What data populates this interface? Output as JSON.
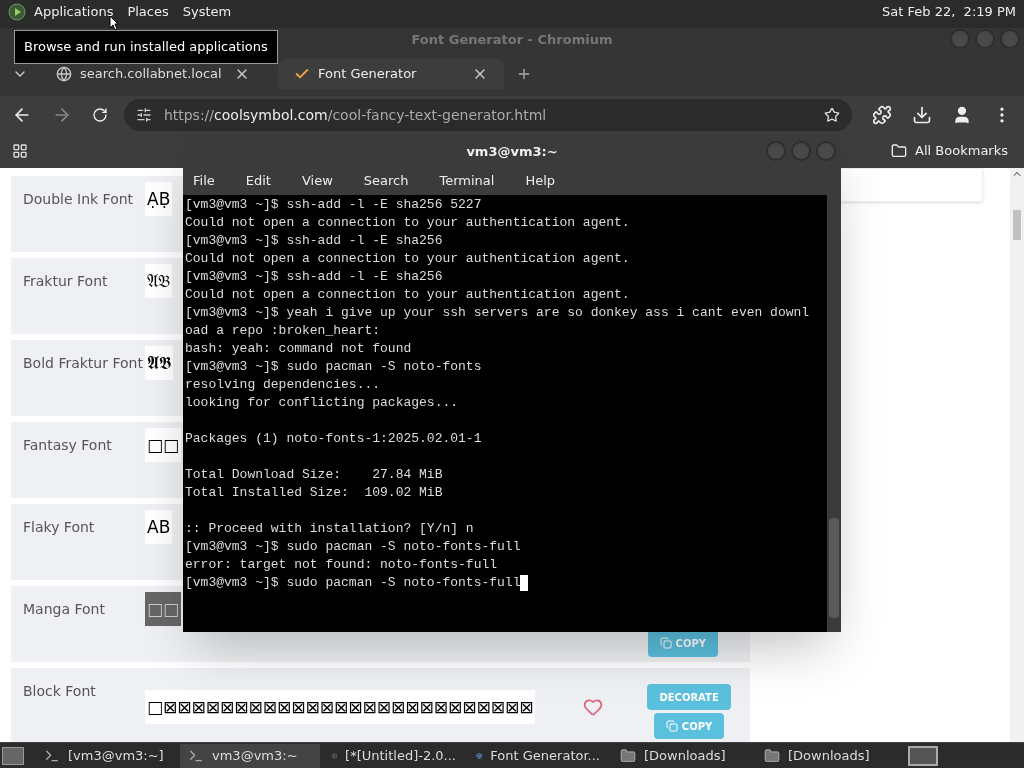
{
  "top_panel": {
    "menus": [
      "Applications",
      "Places",
      "System"
    ],
    "clock": "Sat Feb 22,  2:19 PM"
  },
  "tooltip": "Browse and run installed applications",
  "browser": {
    "title": "Font Generator - Chromium",
    "tabs": [
      {
        "label": "search.collabnet.local",
        "kind": "globe",
        "selected": false
      },
      {
        "label": "Font Generator",
        "kind": "check",
        "selected": true
      }
    ],
    "url": {
      "scheme": "https://",
      "domain": "coolsymbol.com",
      "path": "/cool-fancy-text-generator.html"
    },
    "bookmarks": "All Bookmarks",
    "fonts": [
      {
        "name": "Double Ink Font",
        "sample": "ẠḄ",
        "kind": "plain"
      },
      {
        "name": "Fraktur Font",
        "sample": "𝔄𝔅",
        "kind": "plain"
      },
      {
        "name": "Bold Fraktur Font",
        "sample": "𝕬𝕭",
        "kind": "plain"
      },
      {
        "name": "Fantasy Font",
        "sample": "□□",
        "kind": "plain"
      },
      {
        "name": "Flaky Font",
        "sample": "AB",
        "kind": "plain"
      },
      {
        "name": "Manga Font",
        "sample": "□□",
        "kind": "dark",
        "buttons": [
          "COPY"
        ]
      },
      {
        "name": "Block Font",
        "sample": "□⊠⊠⊠⊠⊠⊠⊠⊠⊠⊠⊠⊠⊠⊠⊠⊠⊠⊠⊠⊠⊠⊠⊠⊠⊠⊠",
        "kind": "plain",
        "favorite": false,
        "buttons": [
          "DECORATE",
          "COPY"
        ]
      }
    ]
  },
  "terminal": {
    "title": "vm3@vm3:~",
    "menus": [
      "File",
      "Edit",
      "View",
      "Search",
      "Terminal",
      "Help"
    ],
    "blocks": [
      [
        "[vm3@vm3 ~]$ ssh-add -l -E sha256 5227",
        "Could not open a connection to your authentication agent.",
        "[vm3@vm3 ~]$ ssh-add -l -E sha256",
        "Could not open a connection to your authentication agent.",
        "[vm3@vm3 ~]$ ssh-add -l -E sha256",
        "Could not open a connection to your authentication agent.",
        "[vm3@vm3 ~]$ yeah i give up your ssh servers are so donkey ass i cant even downl",
        "oad a repo :broken_heart:",
        "bash: yeah: command not found",
        "[vm3@vm3 ~]$ sudo pacman -S noto-fonts",
        "resolving dependencies...",
        "looking for conflicting packages..."
      ],
      [
        "Packages (1) noto-fonts-1:2025.02.01-1"
      ],
      [
        "Total Download Size:    27.84 MiB",
        "Total Installed Size:  109.02 MiB"
      ],
      [
        ":: Proceed with installation? [Y/n] n",
        "[vm3@vm3 ~]$ sudo pacman -S noto-fonts-full",
        "error: target not found: noto-fonts-full",
        "[vm3@vm3 ~]$ sudo pacman -S noto-fonts-full"
      ]
    ]
  },
  "taskbar": [
    {
      "label": "[vm3@vm3:~]",
      "kind": "terminal",
      "selected": false
    },
    {
      "label": "vm3@vm3:~",
      "kind": "terminal",
      "selected": true
    },
    {
      "label": "[*[Untitled]-2.0...",
      "kind": "image",
      "selected": false
    },
    {
      "label": "Font Generator...",
      "kind": "browser",
      "selected": false
    },
    {
      "label": "[Downloads]",
      "kind": "folder",
      "selected": false
    },
    {
      "label": "[Downloads]",
      "kind": "folder",
      "selected": false
    }
  ]
}
